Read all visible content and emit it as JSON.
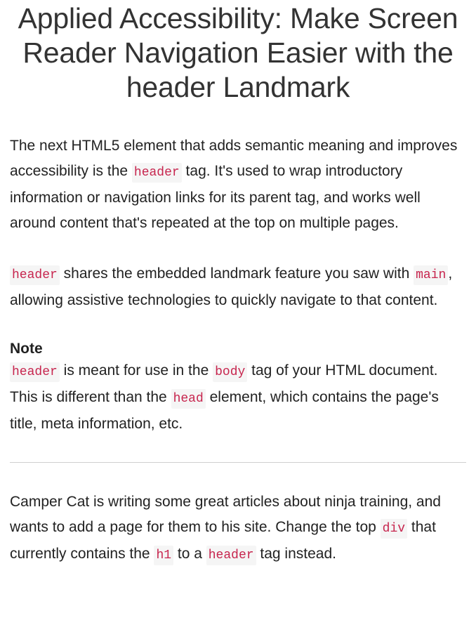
{
  "title": "Applied Accessibility: Make Screen Reader Navigation Easier with the header Landmark",
  "paragraph1": {
    "t1": "The next HTML5 element that adds semantic meaning and improves accessibility is the ",
    "c1": "header",
    "t2": " tag. It's used to wrap introductory information or navigation links for its parent tag, and works well around content that's repeated at the top on multiple pages."
  },
  "paragraph2": {
    "c1": "header",
    "t1": " shares the embedded landmark feature you saw with ",
    "c2": "main",
    "t2": ", allowing assistive technologies to quickly navigate to that content."
  },
  "note": {
    "heading": "Note",
    "c1": "header",
    "t1": " is meant for use in the ",
    "c2": "body",
    "t2": " tag of your HTML document. This is different than the ",
    "c3": "head",
    "t3": " element, which contains the page's title, meta information, etc."
  },
  "instructions": {
    "t1": "Camper Cat is writing some great articles about ninja training, and wants to add a page for them to his site. Change the top ",
    "c1": "div",
    "t2": " that currently contains the ",
    "c2": "h1",
    "t3": " to a ",
    "c3": "header",
    "t4": " tag instead."
  },
  "colors": {
    "code_text": "#c7254e",
    "code_background": "#f5f5f5",
    "body_text": "#222222",
    "divider": "#d0d0d0"
  }
}
